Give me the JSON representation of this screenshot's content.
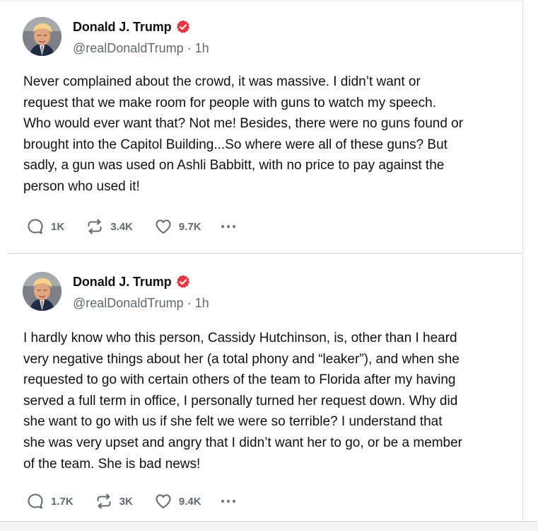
{
  "colors": {
    "verified_badge": "#e8363f",
    "text": "#111111",
    "secondary_text": "#606870",
    "divider": "#e8e8e8"
  },
  "posts": [
    {
      "author": {
        "name": "Donald J. Trump",
        "handle": "@realDonaldTrump",
        "time": "1h",
        "verified_icon": "verified-badge-icon",
        "avatar_icon": "profile-photo"
      },
      "text": "Never complained about the crowd, it was massive. I didn’t want or\nrequest that we make room for people with guns to watch my speech.\nWho would ever want that? Not me! Besides, there were no guns found or\nbrought into the Capitol Building...So where were all of these guns? But\nsadly, a gun was used on Ashli Babbitt, with no price to pay against the\nperson who used it!",
      "actions": {
        "replies": "1K",
        "reposts": "3.4K",
        "likes": "9.7K"
      }
    },
    {
      "author": {
        "name": "Donald J. Trump",
        "handle": "@realDonaldTrump",
        "time": "1h",
        "verified_icon": "verified-badge-icon",
        "avatar_icon": "profile-photo"
      },
      "text": "I hardly know who this person, Cassidy Hutchinson, is, other than I heard\nvery negative things about her (a total phony and “leaker”), and when she\nrequested to go with certain others of the team to Florida after my having\nserved a full term in office, I personally turned her request down. Why did\nshe want to go with us if she felt we were so terrible? I understand that\nshe was very upset and angry that I didn’t want her to go, or be a member\nof the team. She is bad news!",
      "actions": {
        "replies": "1.7K",
        "reposts": "3K",
        "likes": "9.4K"
      }
    }
  ],
  "icons": {
    "reply": "reply-icon",
    "repost": "repost-icon",
    "like": "heart-icon",
    "more": "more-options-icon"
  },
  "meta_separator": "·"
}
